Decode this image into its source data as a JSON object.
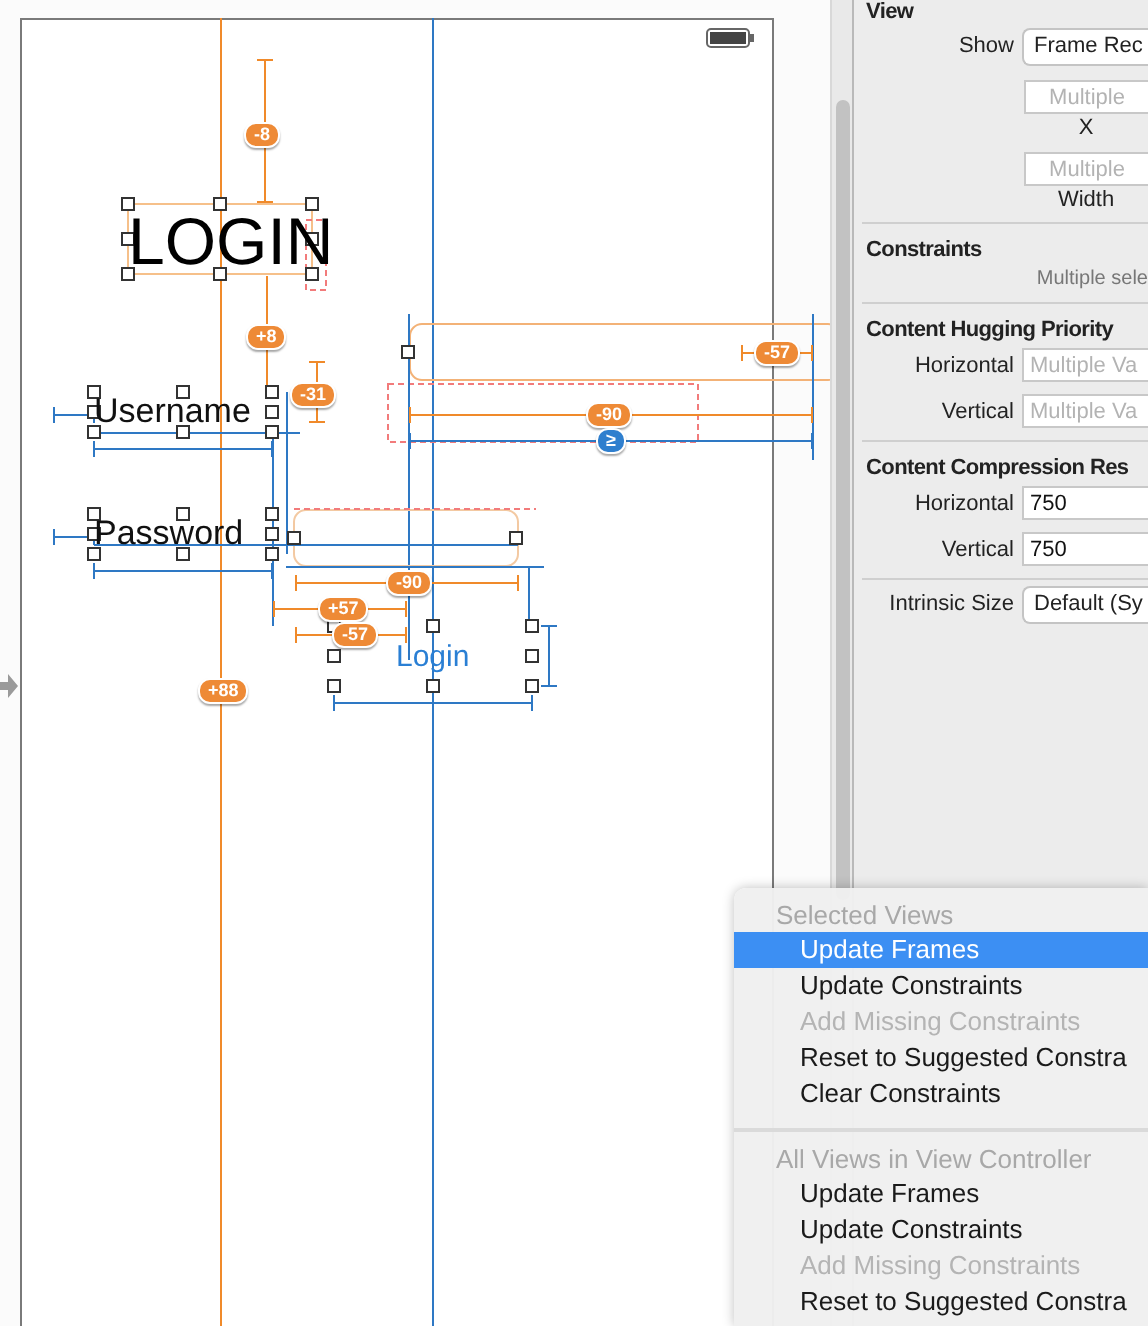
{
  "canvas": {
    "title_label": "LOGIN",
    "field_labels": [
      "Username",
      "Password"
    ],
    "button_label": "Login",
    "constraints": [
      {
        "value": "-8",
        "color": "#ee8a36"
      },
      {
        "value": "+8",
        "color": "#ee8a36"
      },
      {
        "value": "-31",
        "color": "#ee8a36"
      },
      {
        "value": "-57",
        "color": "#ee8a36"
      },
      {
        "value": "-90",
        "color": "#ee8a36"
      },
      {
        "value": "≥",
        "color": "#2f7fce"
      },
      {
        "value": "-90",
        "color": "#ee8a36"
      },
      {
        "value": "+57",
        "color": "#ee8a36"
      },
      {
        "value": "-57",
        "color": "#ee8a36"
      },
      {
        "value": "+88",
        "color": "#ee8a36"
      }
    ]
  },
  "inspector": {
    "section_title": "View",
    "show": {
      "label": "Show",
      "value": "Frame Rec"
    },
    "frame_fields": [
      {
        "placeholder": "Multiple",
        "caption": "X"
      },
      {
        "placeholder": "Multiple",
        "caption": "Width"
      }
    ],
    "constraints": {
      "title": "Constraints",
      "note": "Multiple sele"
    },
    "priority_sections": [
      {
        "title": "Content Hugging Priority",
        "rows": [
          {
            "label": "Horizontal",
            "placeholder": "Multiple Va"
          },
          {
            "label": "Vertical",
            "placeholder": "Multiple Va"
          }
        ]
      },
      {
        "title": "Content Compression Res",
        "rows": [
          {
            "label": "Horizontal",
            "value": "750"
          },
          {
            "label": "Vertical",
            "value": "750"
          }
        ]
      }
    ],
    "intrinsic_size": {
      "label": "Intrinsic Size",
      "value": "Default (Sy"
    }
  },
  "menu": {
    "sections": [
      {
        "header": "Selected Views",
        "items": [
          {
            "label": "Update Frames",
            "selected": true,
            "disabled": false
          },
          {
            "label": "Update Constraints",
            "selected": false,
            "disabled": false
          },
          {
            "label": "Add Missing Constraints",
            "selected": false,
            "disabled": true
          },
          {
            "label": "Reset to Suggested Constra",
            "selected": false,
            "disabled": false
          },
          {
            "label": "Clear Constraints",
            "selected": false,
            "disabled": false
          }
        ]
      },
      {
        "header": "All Views in View Controller",
        "items": [
          {
            "label": "Update Frames",
            "selected": false,
            "disabled": false
          },
          {
            "label": "Update Constraints",
            "selected": false,
            "disabled": false
          },
          {
            "label": "Add Missing Constraints",
            "selected": false,
            "disabled": true
          },
          {
            "label": "Reset to Suggested Constra",
            "selected": false,
            "disabled": false
          }
        ]
      }
    ]
  }
}
